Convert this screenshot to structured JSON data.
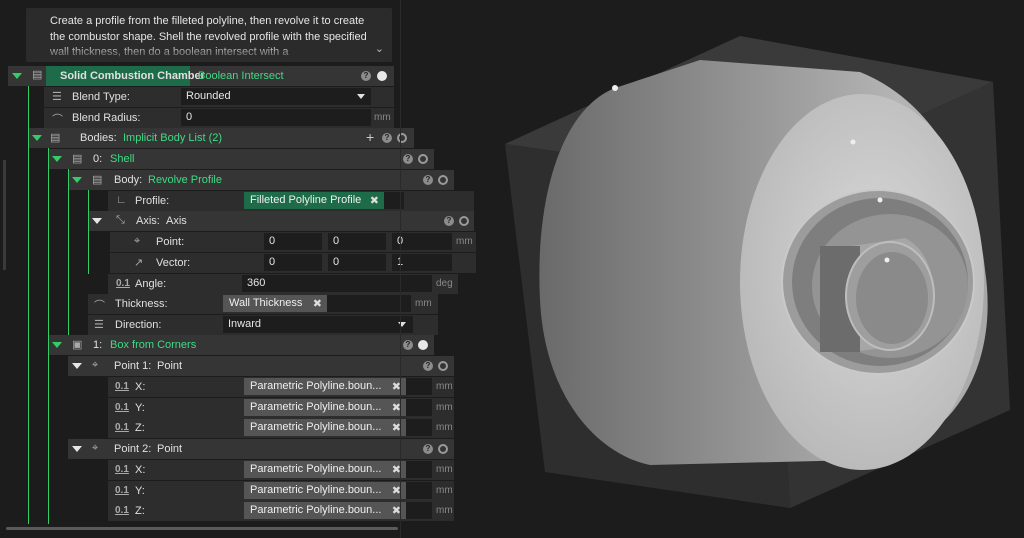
{
  "description": "Create a profile from the filleted polyline, then revolve it to create the combustor shape. Shell the revolved profile with the specified wall thickness, then do a boolean intersect with a",
  "root": {
    "name": "Solid Combustion Chamber",
    "operation": "Boolean Intersect"
  },
  "blend_type": {
    "label": "Blend Type:",
    "value": "Rounded"
  },
  "blend_radius": {
    "label": "Blend Radius:",
    "value": "0",
    "unit": "mm"
  },
  "bodies": {
    "label": "Bodies:",
    "type": "Implicit Body List (2)"
  },
  "shell": {
    "index": "0:",
    "name": "Shell",
    "body": {
      "label": "Body:",
      "type": "Revolve Profile"
    },
    "profile": {
      "label": "Profile:",
      "value": "Filleted Polyline Profile"
    },
    "axis": {
      "label": "Axis:",
      "type": "Axis"
    },
    "point": {
      "label": "Point:",
      "values": [
        "0",
        "0",
        "0"
      ],
      "unit": "mm"
    },
    "vector": {
      "label": "Vector:",
      "values": [
        "0",
        "0",
        "1"
      ]
    },
    "angle": {
      "label": "Angle:",
      "value": "360",
      "unit": "deg"
    },
    "thickness": {
      "label": "Thickness:",
      "value": "Wall Thickness",
      "unit": "mm"
    },
    "direction": {
      "label": "Direction:",
      "value": "Inward"
    }
  },
  "box": {
    "index": "1:",
    "name": "Box from Corners",
    "point1": {
      "label": "Point 1:",
      "type": "Point"
    },
    "point2": {
      "label": "Point 2:",
      "type": "Point"
    },
    "x_label": "X:",
    "y_label": "Y:",
    "z_label": "Z:",
    "ref_value": "Parametric Polyline.boun...",
    "unit": "mm"
  },
  "icons": {
    "help": "?",
    "remove": "✖",
    "add": "+"
  }
}
